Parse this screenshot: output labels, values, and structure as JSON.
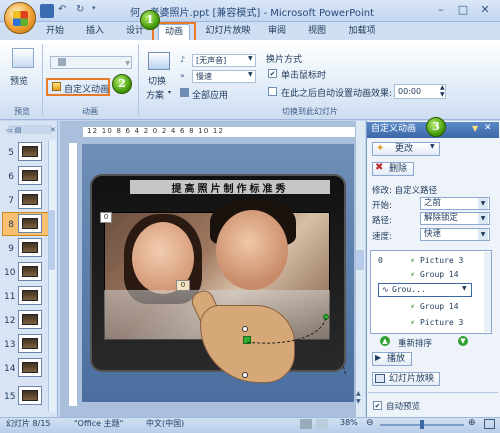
{
  "window": {
    "title": "何...老婆照片.ppt [兼容模式] - Microsoft PowerPoint",
    "minimize": "–",
    "maximize": "□",
    "close": "✕"
  },
  "tabs": [
    {
      "label": "开始"
    },
    {
      "label": "插入"
    },
    {
      "label": "设计"
    },
    {
      "label": "动画",
      "active": true
    },
    {
      "label": "幻灯片放映"
    },
    {
      "label": "审阅"
    },
    {
      "label": "视图"
    },
    {
      "label": "加载项"
    }
  ],
  "ribbon": {
    "preview_label": "预览",
    "preview_group": "预览",
    "custom_anim_label": "自定义动画",
    "anim_group": "动画",
    "switch_scheme_line1": "切换",
    "switch_scheme_line2": "方案",
    "sound_value": "[无声音]",
    "speed_value": "慢速",
    "apply_all": "全部应用",
    "switch_mode_title": "换片方式",
    "on_click": "单击鼠标时",
    "auto_after": "在此之后自动设置动画效果:",
    "auto_time": "00:00",
    "switch_group": "切换到此幻灯片"
  },
  "callouts": [
    "1",
    "2",
    "3"
  ],
  "thumbnails": [
    "5",
    "6",
    "7",
    "8",
    "9",
    "10",
    "11",
    "12",
    "13",
    "14",
    "15"
  ],
  "ruler_text": "12  10  8  6  4  2  0  2  4  6  8  10  12",
  "slide": {
    "title": "提高照片制作标准秀",
    "tag0": "0",
    "tag0b": "0"
  },
  "custom_anim": {
    "header": "自定义动画",
    "change_btn": "更改",
    "delete_btn": "删除",
    "modify_label": "修改: 自定义路径",
    "start_label": "开始:",
    "start_value": "之前",
    "path_label": "路径:",
    "path_value": "解除锁定",
    "speed_label": "速度:",
    "speed_value": "快速",
    "list_index": "0",
    "items": [
      "Picture 3",
      "Group 14",
      "Grou...",
      "Group 14",
      "Picture 3"
    ],
    "reorder_label": "重新排序",
    "play_btn": "播放",
    "slideshow_btn": "幻灯片放映",
    "autopreview": "自动预览"
  },
  "status": {
    "slide_info": "幻灯片 8/15",
    "theme": "\"Office 主题\"",
    "language": "中文(中国)",
    "zoom": "38%"
  }
}
